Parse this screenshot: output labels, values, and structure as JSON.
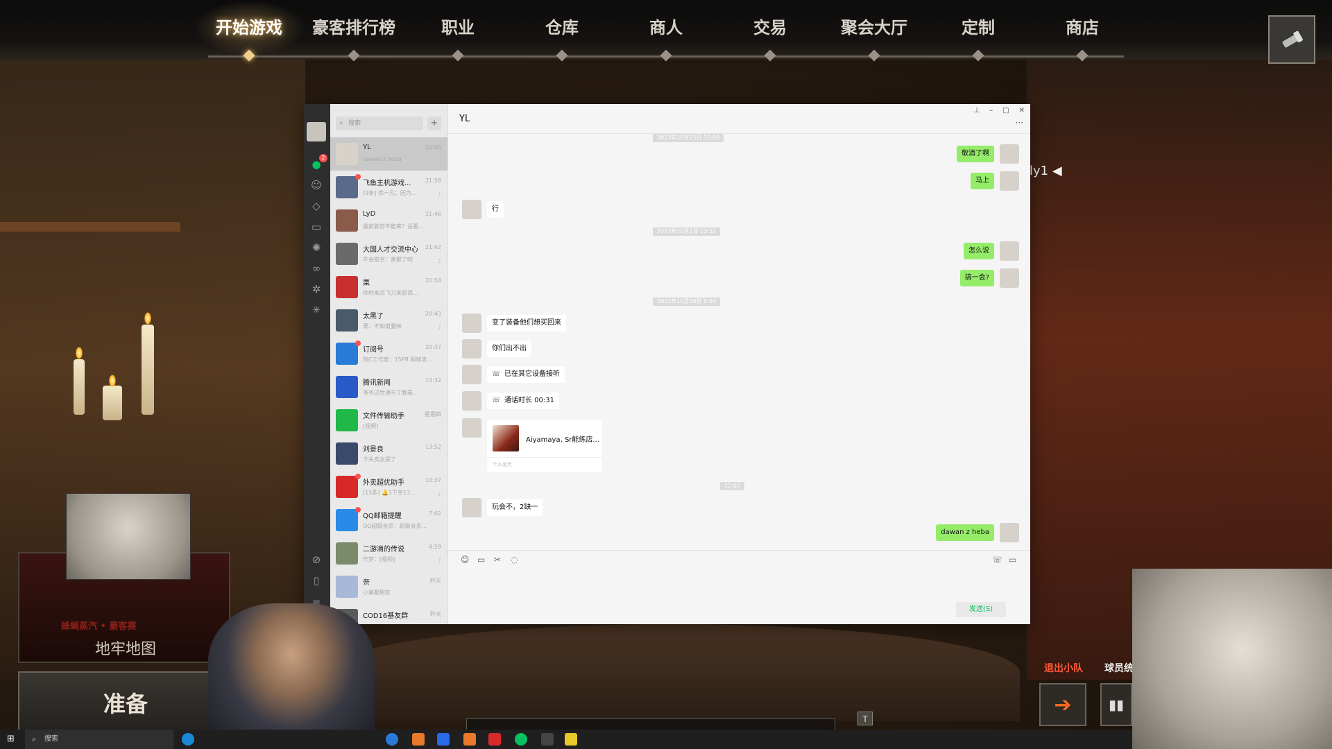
{
  "nav": {
    "items": [
      "开始游戏",
      "豪客排行榜",
      "职业",
      "仓库",
      "商人",
      "交易",
      "聚会大厅",
      "定制",
      "商店"
    ],
    "active_index": 0
  },
  "wechat": {
    "search_placeholder": "搜索",
    "rail_badge": "2",
    "chat_title": "YL",
    "chats": [
      {
        "name": "YL",
        "time": "22:04",
        "preview": "dawan z heba",
        "selected": true,
        "color": "#d8d2c8"
      },
      {
        "name": "飞鱼主机游戏...",
        "time": "21:58",
        "preview": "[9条] 徐一凡：因为...",
        "dot": true,
        "mute": true,
        "color": "#5a6a8a"
      },
      {
        "name": "LyD",
        "time": "21:46",
        "preview": "最前就亦不能来？设看...",
        "color": "#8a5a4a"
      },
      {
        "name": "大国人才交流中心",
        "time": "21:42",
        "preview": "不会取名：寄那了吧",
        "mute": true,
        "color": "#6a6a6a"
      },
      {
        "name": "栗",
        "time": "20:54",
        "preview": "你你来点飞刀来获得...",
        "color": "#c83030"
      },
      {
        "name": "太黑了",
        "time": "20:43",
        "preview": "栗：不知道要咪",
        "mute": true,
        "color": "#4a5a6a"
      },
      {
        "name": "订阅号",
        "time": "20:37",
        "preview": "热C工作室：15P8 网咪攻...",
        "dot": true,
        "color": "#2a7ad8"
      },
      {
        "name": "腾讯新闻",
        "time": "14:32",
        "preview": "爷爷过世通不了我看...",
        "color": "#2a5ac8"
      },
      {
        "name": "文件传输助手",
        "time": "星期四",
        "preview": "[视频]",
        "color": "#20b848"
      },
      {
        "name": "刘景良",
        "time": "13:52",
        "preview": "下头卖女提了",
        "color": "#3a4a6a"
      },
      {
        "name": "外卖超优助手",
        "time": "10:37",
        "preview": "[15条] 🔔1下单13...",
        "dot": true,
        "mute": true,
        "color": "#d82828"
      },
      {
        "name": "QQ邮箱提醒",
        "time": "7:02",
        "preview": "QQ超级会员：超级会员...",
        "dot": true,
        "color": "#2a8ae8"
      },
      {
        "name": "二游滴的传说",
        "time": "4:59",
        "preview": "作梦：[视频]",
        "mute": true,
        "color": "#7a8a6a"
      },
      {
        "name": "奈",
        "time": "昨天",
        "preview": "小事都朋友",
        "color": "#a8b8d8"
      },
      {
        "name": "COD16基友群",
        "time": "昨天",
        "preview": "",
        "color": "#5a5a5a"
      }
    ],
    "messages": {
      "ts_top": "2023年10月15日 22:03",
      "m1": "敬酒了啊",
      "m2": "马上",
      "m3": "行",
      "ts2": "2023年10月1日 13:52",
      "m4": "怎么说",
      "m5": "搞一会?",
      "ts3": "2023年10月16日 0:50",
      "m6": "变了装备他们想买回来",
      "m7": "你们出不出",
      "m8": "已在其它设备接听",
      "m9": "通话时长 00:31",
      "card_name": "Aiyamaya, Sr能练店...",
      "card_foot": "个人名片",
      "ts4": "22:03",
      "m10": "玩会不，2缺一",
      "m11": "dawan z heba"
    },
    "send_label": "发送(S)"
  },
  "overlay": {
    "dungeon_red": "蜂蝇蒸汽 • 豪客赛",
    "dungeon_label": "地牢地图",
    "ready_label": "准备",
    "red_text": "退出小队",
    "white_text": "球员统",
    "ly_label": "ly1",
    "t_key": "T"
  },
  "taskbar": {
    "search_placeholder": "搜索"
  }
}
